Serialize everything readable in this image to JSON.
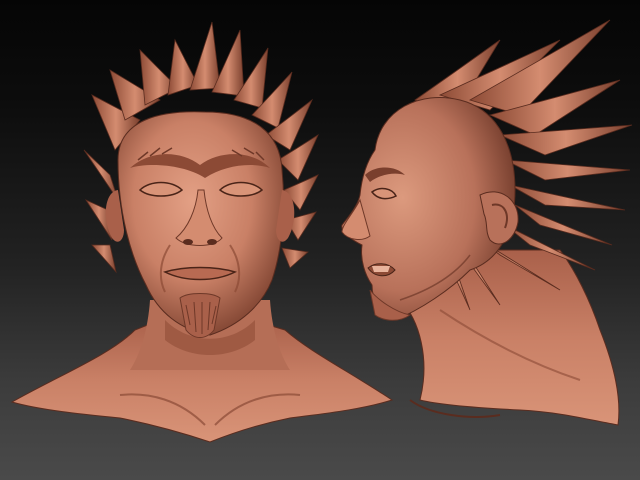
{
  "scene": {
    "background_top": "#050505",
    "background_bottom": "#4a4a4a",
    "clay_base": "#c98066",
    "clay_light": "#e3a085",
    "clay_shadow": "#6e3828",
    "clay_deep": "#3f1d14"
  },
  "views": [
    {
      "name": "front-view"
    },
    {
      "name": "side-view"
    }
  ]
}
